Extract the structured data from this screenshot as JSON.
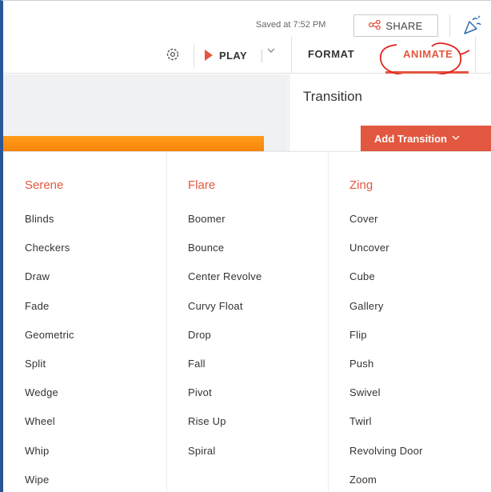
{
  "header": {
    "saved_text": "Saved at 7:52 PM",
    "share_label": "SHARE",
    "share_icon": "share-nodes-icon",
    "collab_icon": "party-popper-icon"
  },
  "toolbar": {
    "settings_icon": "settings-gear-icon",
    "play_label": "PLAY",
    "tabs": [
      {
        "label": "FORMAT",
        "active": false
      },
      {
        "label": "ANIMATE",
        "active": true
      }
    ],
    "accent_color": "#e2573f"
  },
  "panel": {
    "title": "Transition",
    "add_button_label": "Add Transition",
    "add_button_chevron": "⌵"
  },
  "transitions": {
    "columns": [
      {
        "heading": "Serene",
        "items": [
          "Blinds",
          "Checkers",
          "Draw",
          "Fade",
          "Geometric",
          "Split",
          "Wedge",
          "Wheel",
          "Whip",
          "Wipe"
        ]
      },
      {
        "heading": "Flare",
        "items": [
          "Boomer",
          "Bounce",
          "Center Revolve",
          "Curvy Float",
          "Drop",
          "Fall",
          "Pivot",
          "Rise Up",
          "Spiral"
        ]
      },
      {
        "heading": "Zing",
        "items": [
          "Cover",
          "Uncover",
          "Cube",
          "Gallery",
          "Flip",
          "Push",
          "Swivel",
          "Twirl",
          "Revolving Door",
          "Zoom"
        ]
      }
    ]
  }
}
